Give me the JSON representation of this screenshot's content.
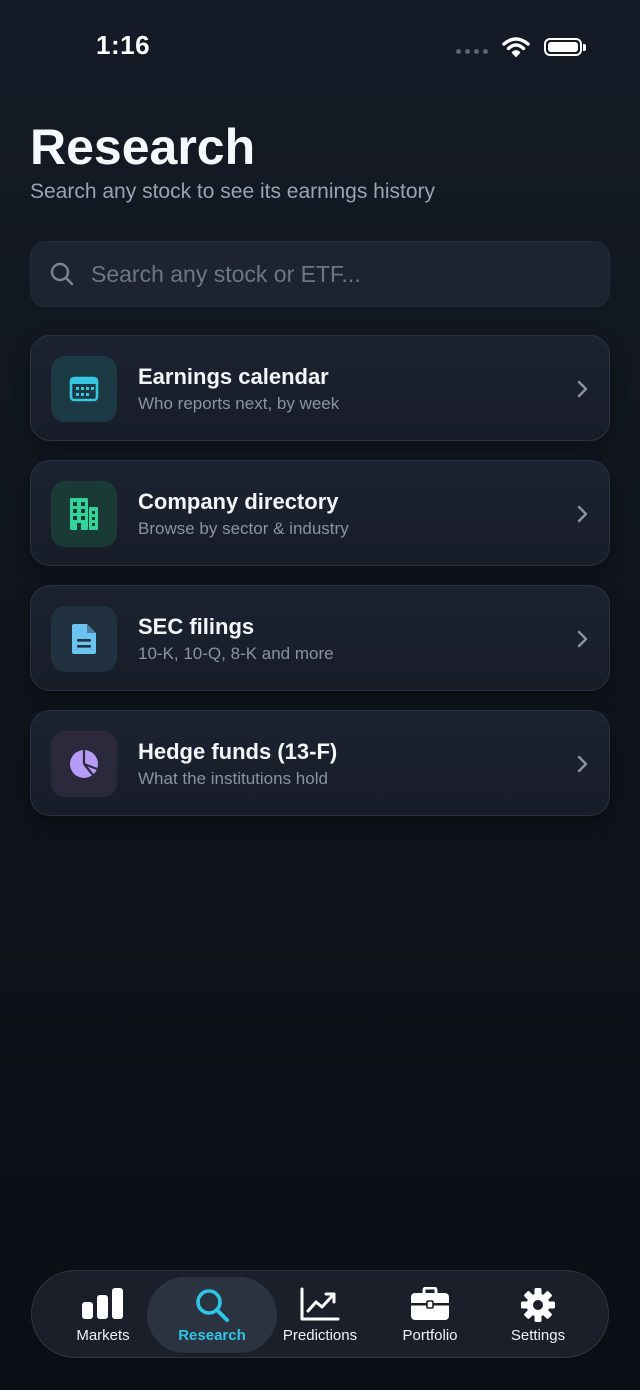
{
  "status_bar": {
    "time": "1:16"
  },
  "header": {
    "title": "Research",
    "subtitle": "Search any stock to see its earnings history"
  },
  "search": {
    "placeholder": "Search any stock or ETF...",
    "value": ""
  },
  "menu": [
    {
      "title": "Earnings calendar",
      "subtitle": "Who reports next, by week",
      "icon": "calendar-icon",
      "tile_color": "#1b3a44",
      "icon_color": "#35c8e0"
    },
    {
      "title": "Company directory",
      "subtitle": "Browse by sector & industry",
      "icon": "building-icon",
      "tile_color": "#1a3a35",
      "icon_color": "#34d39a"
    },
    {
      "title": "SEC filings",
      "subtitle": "10-K, 10-Q, 8-K and more",
      "icon": "document-icon",
      "tile_color": "#22313f",
      "icon_color": "#6cc3f0"
    },
    {
      "title": "Hedge funds (13-F)",
      "subtitle": "What the institutions hold",
      "icon": "pie-chart-icon",
      "tile_color": "#2b2a3d",
      "icon_color": "#b79cf7"
    }
  ],
  "tab_bar": {
    "active": "Research",
    "accent_color": "#2fc6e6",
    "tabs": [
      {
        "label": "Markets",
        "icon": "bar-chart-icon"
      },
      {
        "label": "Research",
        "icon": "search-icon"
      },
      {
        "label": "Predictions",
        "icon": "trend-up-icon"
      },
      {
        "label": "Portfolio",
        "icon": "briefcase-icon"
      },
      {
        "label": "Settings",
        "icon": "gear-icon"
      }
    ]
  }
}
